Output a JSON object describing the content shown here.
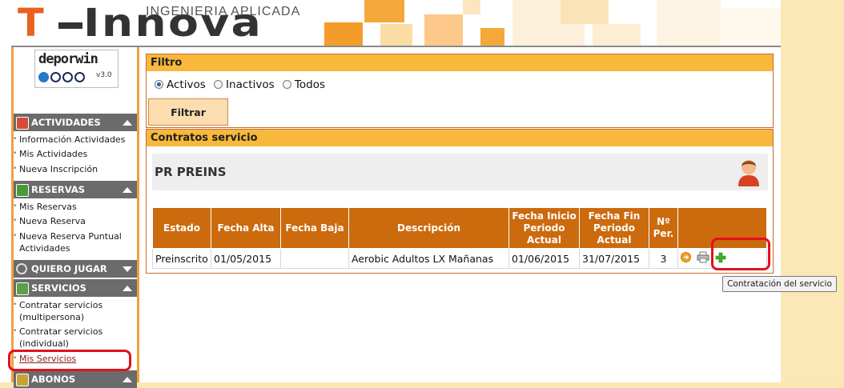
{
  "header": {
    "logo_t": "T",
    "logo_rest": "Innova",
    "logo_subtitle": "INGENIERIA APLICADA",
    "accent_color": "#f39c2a"
  },
  "sidebar": {
    "brand": {
      "name": "deporwin",
      "version": "v3.0"
    },
    "sections": [
      {
        "title": "ACTIVIDADES",
        "icon": "calendar-icon",
        "items": [
          "Información Actividades",
          "Mis Actividades",
          "Nueva Inscripción"
        ]
      },
      {
        "title": "RESERVAS",
        "icon": "court-icon",
        "items": [
          "Mis Reservas",
          "Nueva Reserva",
          "Nueva Reserva Puntual Actividades"
        ]
      },
      {
        "title": "QUIERO JUGAR",
        "icon": "search-icon",
        "items": []
      },
      {
        "title": "SERVICIOS",
        "icon": "calculator-icon",
        "items": [
          "Contratar servicios (multipersona)",
          "Contratar servicios (individual)",
          "Mis Servicios"
        ]
      },
      {
        "title": "ABONOS",
        "icon": "card-icon",
        "items": []
      }
    ]
  },
  "filter": {
    "title": "Filtro",
    "options": [
      "Activos",
      "Inactivos",
      "Todos"
    ],
    "selected": "Activos",
    "button_label": "Filtrar"
  },
  "contracts": {
    "title": "Contratos servicio",
    "person_name": "PR PREINS",
    "columns": [
      "Estado",
      "Fecha Alta",
      "Fecha Baja",
      "Descripción",
      "Fecha Inicio Periodo Actual",
      "Fecha Fin Periodo Actual",
      "Nº Per.",
      ""
    ],
    "rows": [
      {
        "estado": "Preinscrito",
        "fecha_alta": "01/05/2015",
        "fecha_baja": "",
        "descripcion": "Aerobic Adultos LX Mañanas",
        "fecha_inicio": "01/06/2015",
        "fecha_fin": "31/07/2015",
        "num_per": "3"
      }
    ]
  },
  "tooltip": "Contratación del servicio"
}
